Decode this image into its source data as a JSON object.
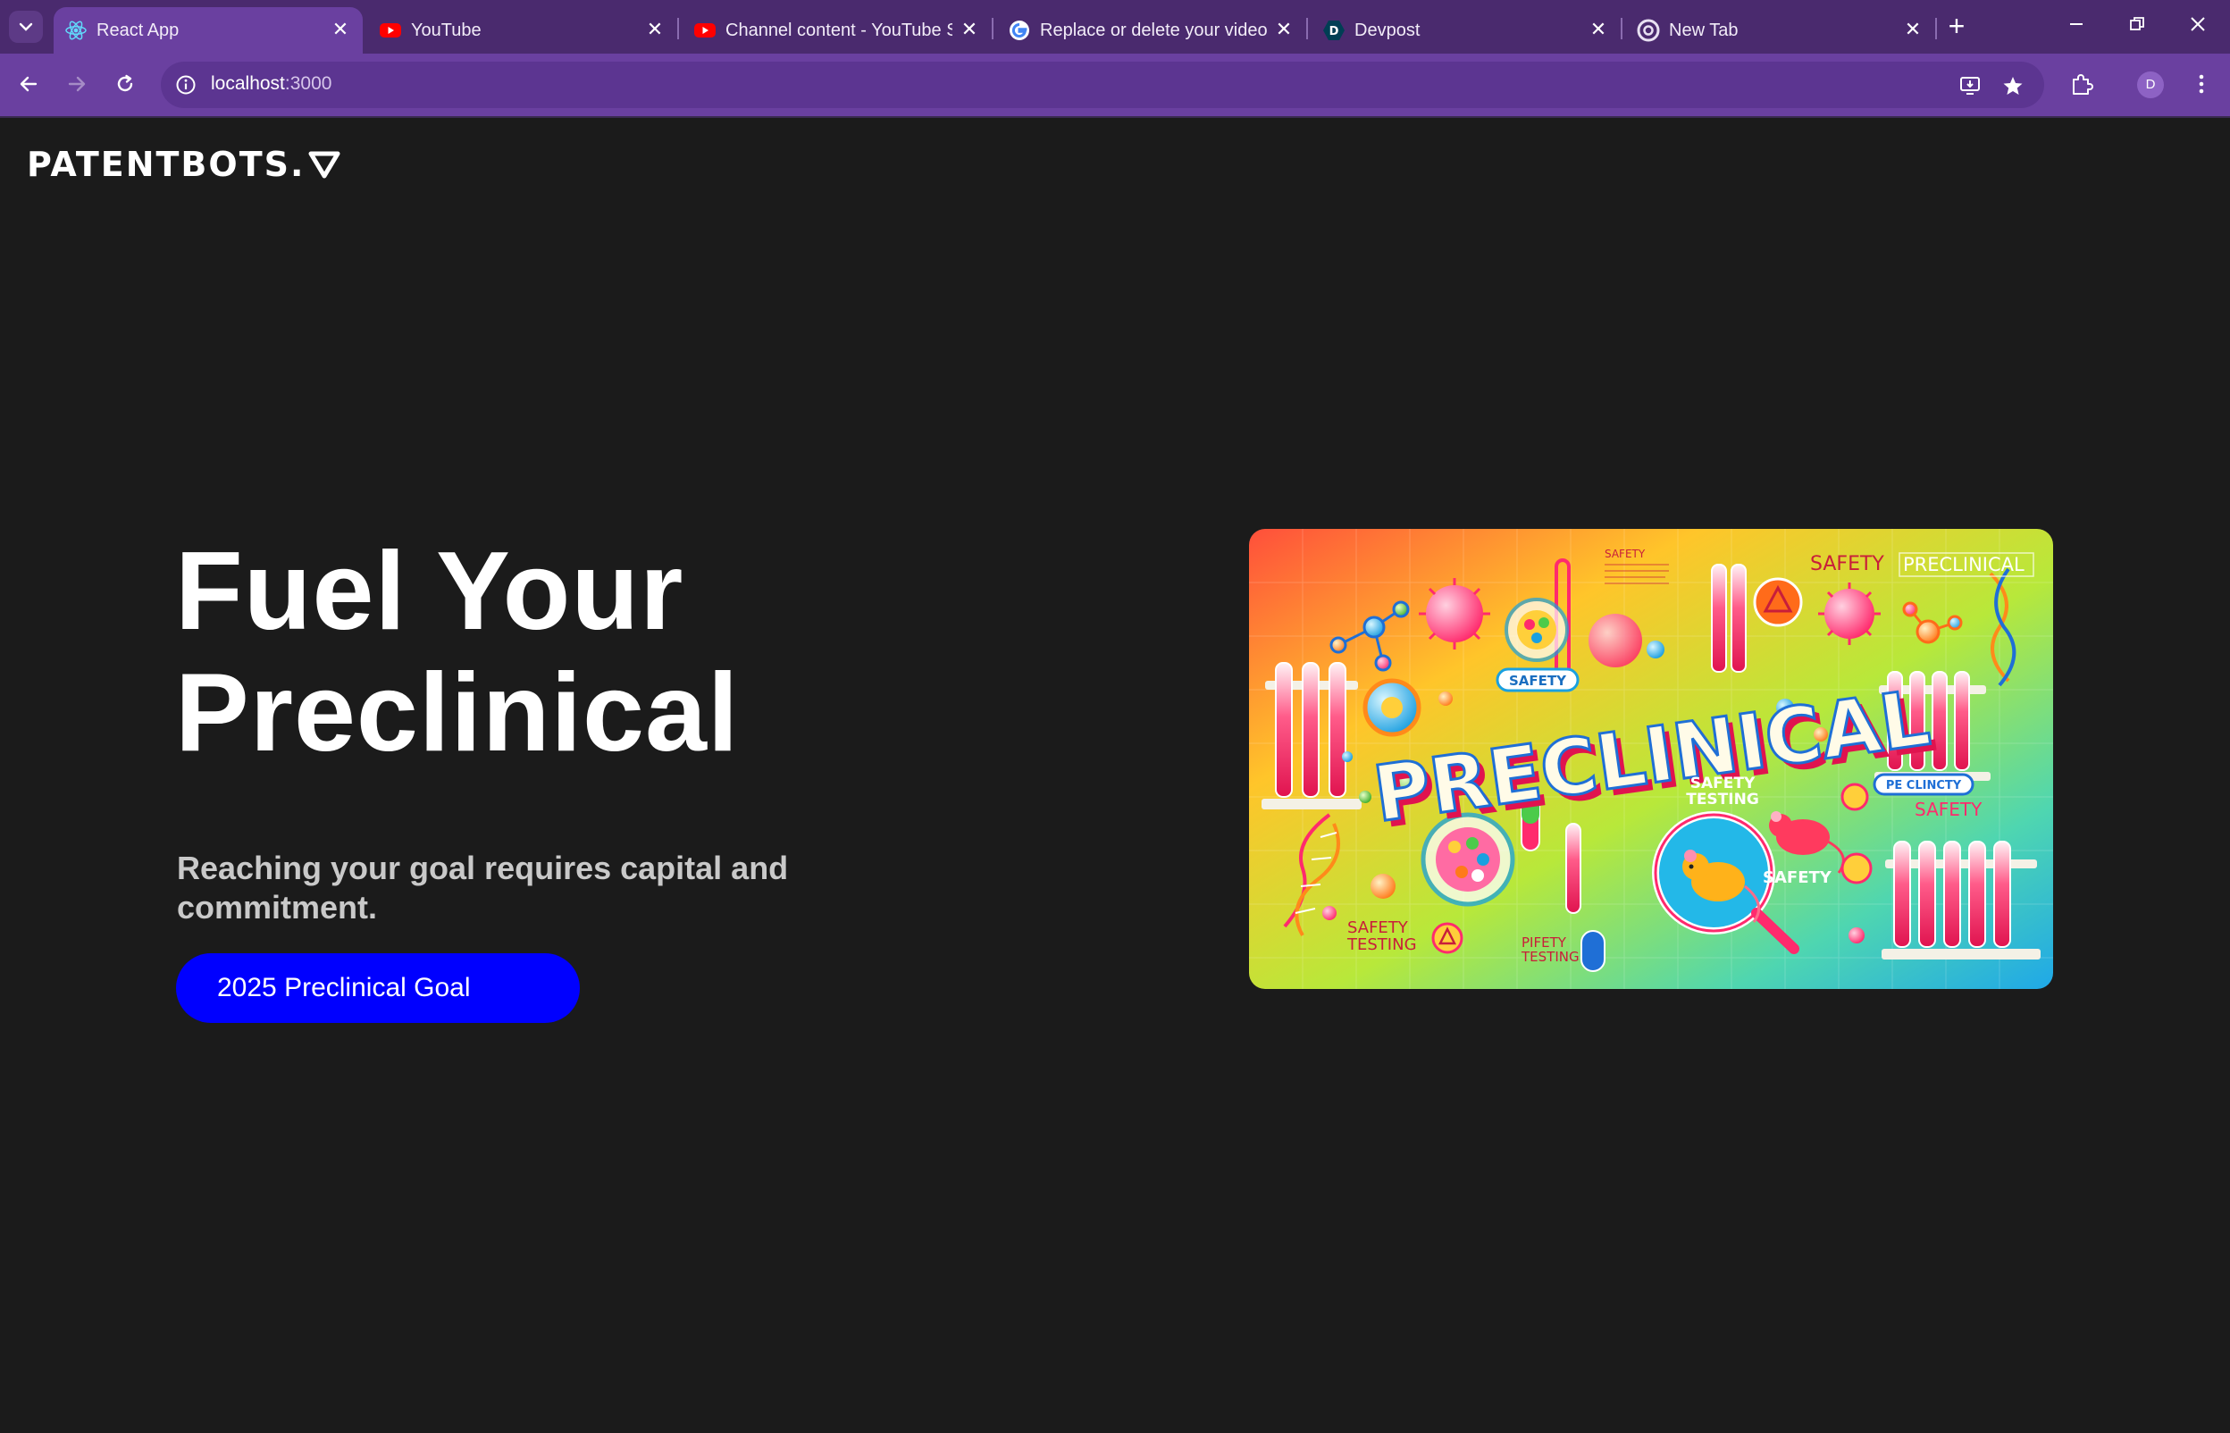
{
  "browser": {
    "tabs": [
      {
        "title": "React App",
        "icon": "react-icon",
        "active": true
      },
      {
        "title": "YouTube",
        "icon": "youtube-icon",
        "active": false
      },
      {
        "title": "Channel content - YouTube Stu",
        "icon": "youtube-icon",
        "active": false
      },
      {
        "title": "Replace or delete your video -",
        "icon": "google-icon",
        "active": false
      },
      {
        "title": "Devpost",
        "icon": "devpost-icon",
        "active": false
      },
      {
        "title": "New Tab",
        "icon": "chrome-icon",
        "active": false
      }
    ],
    "url_host": "localhost",
    "url_port": ":3000",
    "profile_initial": "D"
  },
  "header": {
    "brand": "PATENTBOTS."
  },
  "hero": {
    "title_line1": "Fuel Your",
    "title_line2": "Preclinical",
    "subtitle": "Reaching your goal requires capital and commitment.",
    "cta_label": "2025 Preclinical Goal",
    "image": {
      "alt": "Colorful preclinical illustration",
      "main_word": "PRECLINICAL",
      "labels": [
        "SAFETY",
        "PRECLINICAL",
        "SAFETY",
        "SAFETY TESTING",
        "PE CLINCTY",
        "SAFETY",
        "SAFETY",
        "SAFETY TESTING",
        "PIFETY TESTING",
        "SAFETY"
      ]
    }
  },
  "colors": {
    "page_bg": "#1b1b1b",
    "cta_bg": "#0000ff",
    "chrome_tabstrip": "#4a2a6e",
    "chrome_toolbar": "#6a40a0"
  }
}
